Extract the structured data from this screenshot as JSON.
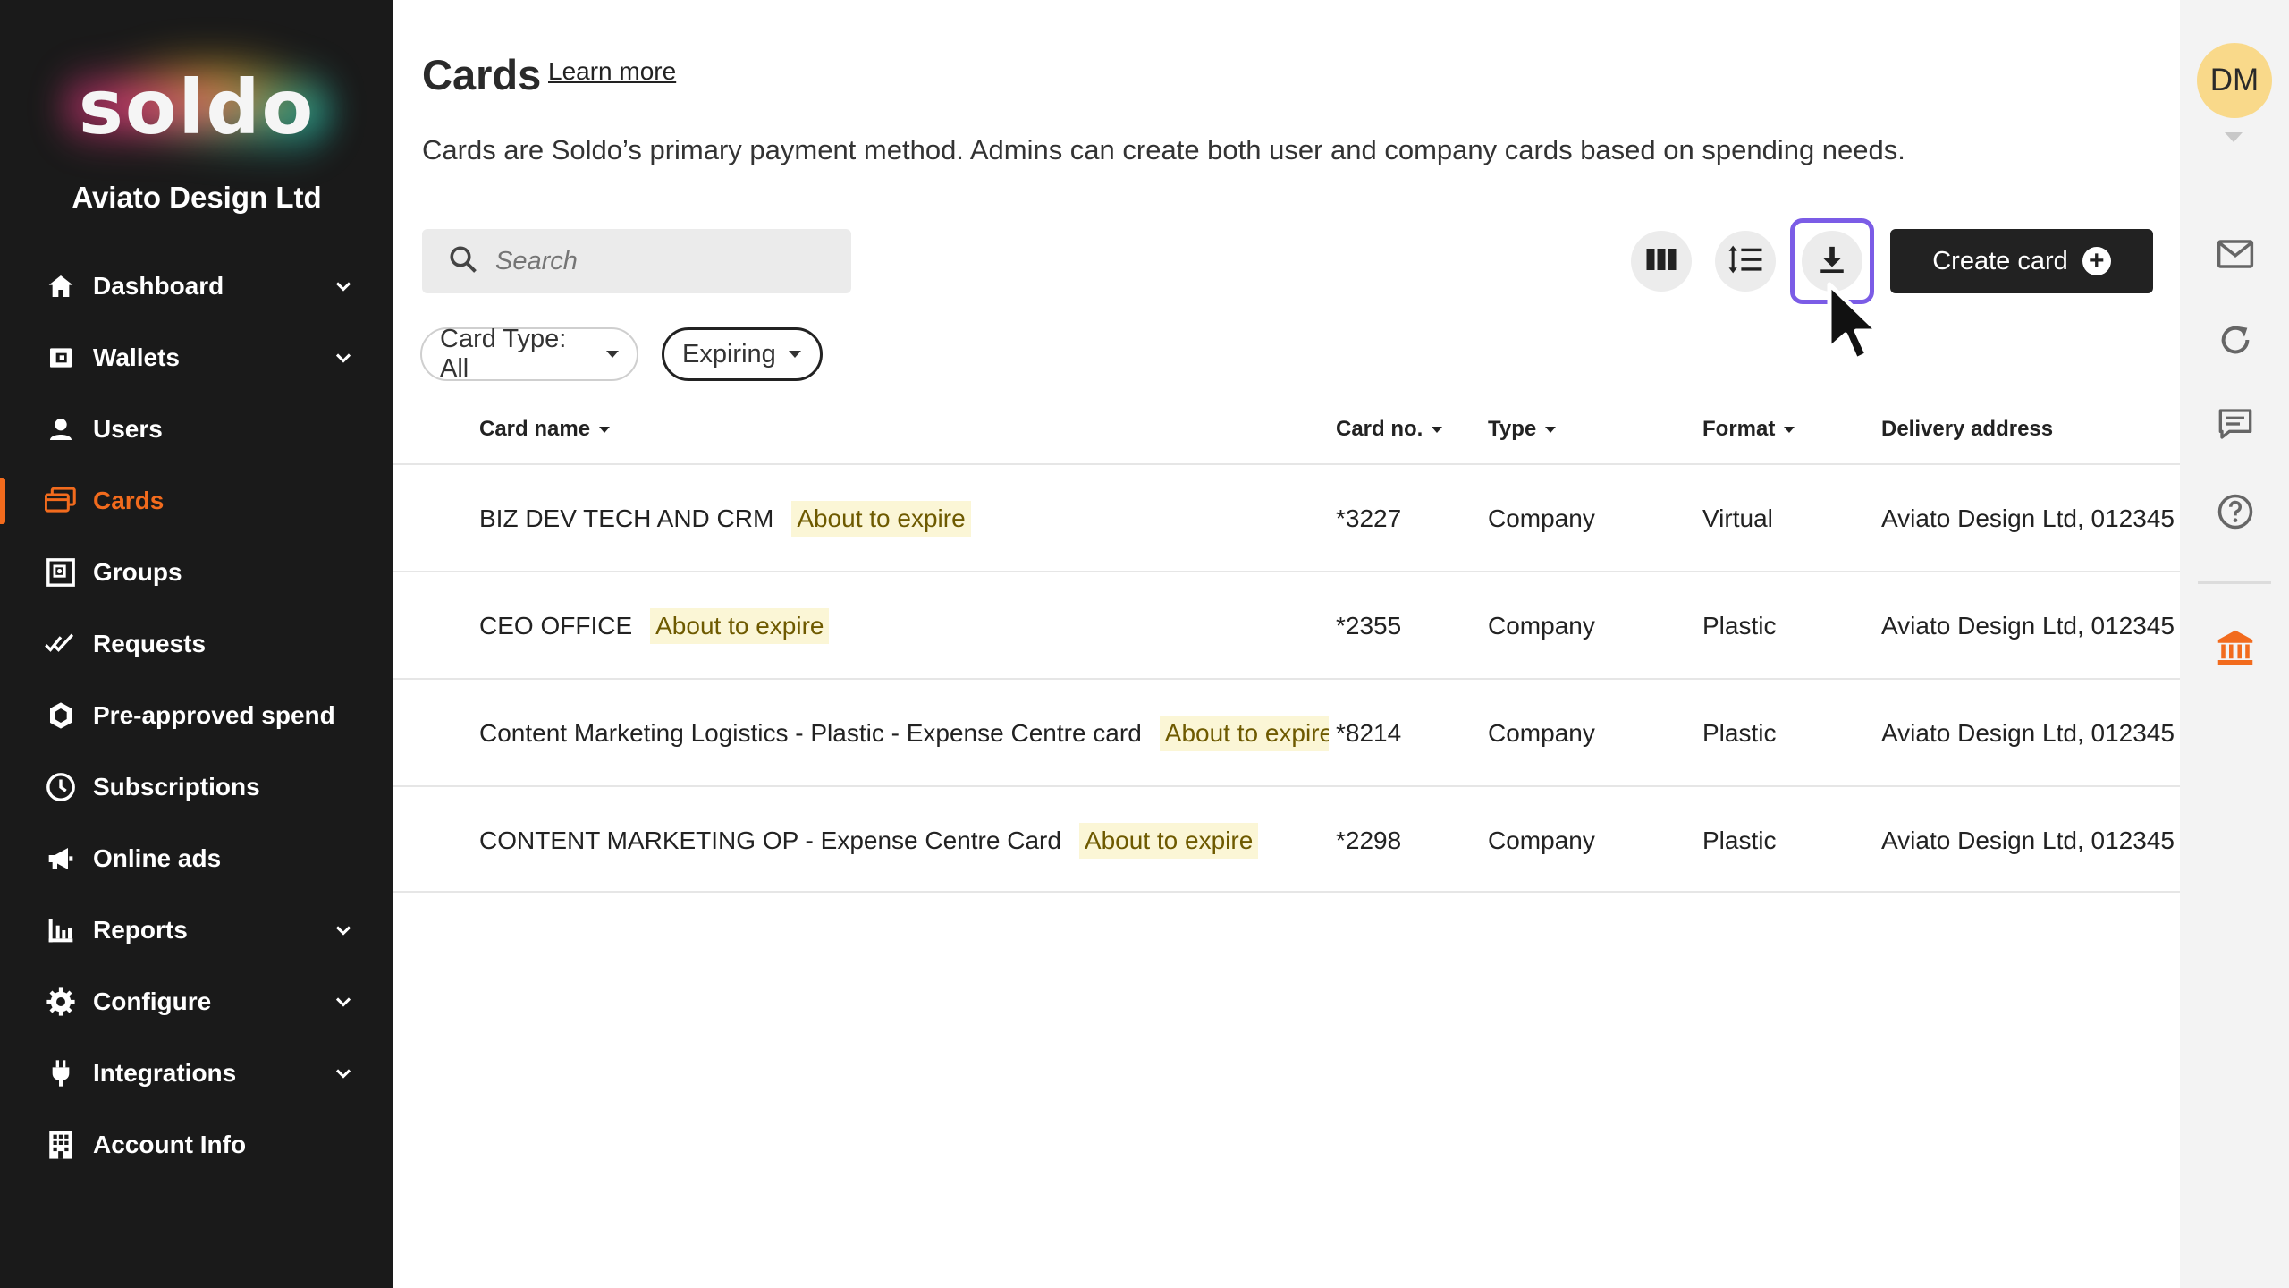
{
  "sidebar": {
    "logo": "soldo",
    "company": "Aviato Design Ltd",
    "items": [
      {
        "label": "Dashboard",
        "icon": "home-icon",
        "has_chevron": true
      },
      {
        "label": "Wallets",
        "icon": "wallet-icon",
        "has_chevron": true
      },
      {
        "label": "Users",
        "icon": "user-icon",
        "has_chevron": false
      },
      {
        "label": "Cards",
        "icon": "cards-icon",
        "has_chevron": false,
        "active": true
      },
      {
        "label": "Groups",
        "icon": "groups-icon",
        "has_chevron": false
      },
      {
        "label": "Requests",
        "icon": "requests-icon",
        "has_chevron": false
      },
      {
        "label": "Pre-approved spend",
        "icon": "shield-icon",
        "has_chevron": false
      },
      {
        "label": "Subscriptions",
        "icon": "clock-icon",
        "has_chevron": false
      },
      {
        "label": "Online ads",
        "icon": "megaphone-icon",
        "has_chevron": false
      },
      {
        "label": "Reports",
        "icon": "bar-chart-icon",
        "has_chevron": true
      },
      {
        "label": "Configure",
        "icon": "gear-icon",
        "has_chevron": true
      },
      {
        "label": "Integrations",
        "icon": "plug-icon",
        "has_chevron": true
      },
      {
        "label": "Account Info",
        "icon": "building-icon",
        "has_chevron": false
      }
    ]
  },
  "header": {
    "title": "Cards",
    "learn_more": "Learn more",
    "description": "Cards are Soldo’s primary payment method. Admins can create both user and company cards based on spending needs."
  },
  "toolbar": {
    "search_placeholder": "Search",
    "create_label": "Create card"
  },
  "filters": {
    "card_type": "Card Type: All",
    "expiring": "Expiring"
  },
  "table": {
    "columns": [
      "Card name",
      "Card no.",
      "Type",
      "Format",
      "Delivery address"
    ],
    "rows": [
      {
        "name": "BIZ DEV TECH AND CRM",
        "badge": "About to expire",
        "card_no": "*3227",
        "type": "Company",
        "format": "Virtual",
        "address": "Aviato Design Ltd, 012345,"
      },
      {
        "name": "CEO OFFICE",
        "badge": "About to expire",
        "card_no": "*2355",
        "type": "Company",
        "format": "Plastic",
        "address": "Aviato Design Ltd, 012345,"
      },
      {
        "name": "Content Marketing Logistics - Plastic - Expense Centre card",
        "badge": "About to expire",
        "card_no": "*8214",
        "type": "Company",
        "format": "Plastic",
        "address": "Aviato Design Ltd, 012345,"
      },
      {
        "name": "CONTENT MARKETING OP - Expense Centre Card",
        "badge": "About to expire",
        "card_no": "*2298",
        "type": "Company",
        "format": "Plastic",
        "address": "Aviato Design Ltd, 012345,"
      }
    ]
  },
  "rail": {
    "avatar_initials": "DM"
  },
  "colors": {
    "sidebar_bg": "#1a1a1a",
    "accent": "#f26b1d",
    "focus_ring": "#7b5ce6",
    "badge_bg": "#fbf6d6"
  }
}
